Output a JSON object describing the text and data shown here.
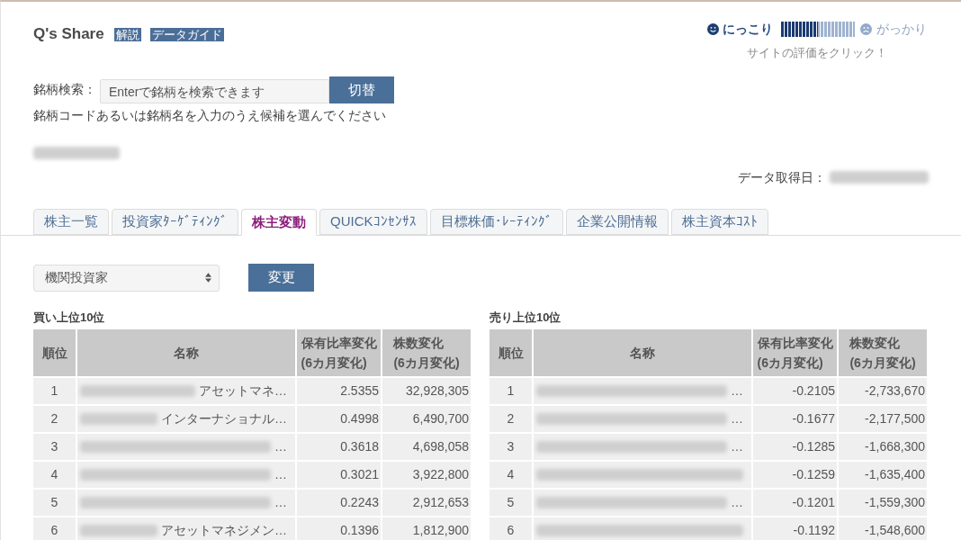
{
  "header": {
    "title": "Q's Share",
    "links": [
      "解説",
      "データガイド"
    ]
  },
  "rating": {
    "positive_label": "にっこり",
    "level": 0.5,
    "negative_label": "がっかり",
    "hint": "サイトの評価をクリック！"
  },
  "search": {
    "label": "銘柄検索：",
    "placeholder": "Enterで銘柄を検索できます",
    "button": "切替",
    "help": "銘柄コードあるいは銘柄名を入力のうえ候補を選んでください"
  },
  "company": {
    "blurred": true
  },
  "data_date": {
    "label": "データ取得日：",
    "value_blurred": true
  },
  "tabs": [
    {
      "label": "株主一覧",
      "selected": false
    },
    {
      "label": "投資家ﾀｰｹﾞﾃｨﾝｸﾞ",
      "selected": false
    },
    {
      "label": "株主変動",
      "selected": true
    },
    {
      "label": "QUICKｺﾝｾﾝｻｽ",
      "selected": false
    },
    {
      "label": "目標株価･ﾚｰﾃｨﾝｸﾞ",
      "selected": false
    },
    {
      "label": "企業公開情報",
      "selected": false
    },
    {
      "label": "株主資本ｺｽﾄ",
      "selected": false
    }
  ],
  "filter": {
    "value": "機関投資家",
    "button": "変更"
  },
  "tables": [
    {
      "title": "買い上位10位",
      "columns": [
        {
          "label": "順位"
        },
        {
          "label": "名称"
        },
        {
          "label": "保有比率変化",
          "sublabel": "(6カ月変化)"
        },
        {
          "label": "株数変化",
          "sublabel": "(6カ月変化)"
        }
      ],
      "rows": [
        {
          "rank": "1",
          "name": "アセットマネ…",
          "blurred": true,
          "ratio": "2.5355",
          "shares": "32,928,305"
        },
        {
          "rank": "2",
          "name": "インターナショナル…",
          "blurred": true,
          "ratio": "0.4998",
          "shares": "6,490,700"
        },
        {
          "rank": "3",
          "name": "…",
          "blurred": true,
          "ratio": "0.3618",
          "shares": "4,698,058"
        },
        {
          "rank": "4",
          "name": "…",
          "blurred": true,
          "ratio": "0.3021",
          "shares": "3,922,800"
        },
        {
          "rank": "5",
          "name": "…",
          "blurred": true,
          "ratio": "0.2243",
          "shares": "2,912,653"
        },
        {
          "rank": "6",
          "name": "アセットマネジメン…",
          "blurred": true,
          "ratio": "0.1396",
          "shares": "1,812,900"
        }
      ]
    },
    {
      "title": "売り上位10位",
      "columns": [
        {
          "label": "順位"
        },
        {
          "label": "名称"
        },
        {
          "label": "保有比率変化",
          "sublabel": "(6カ月変化)"
        },
        {
          "label": "株数変化",
          "sublabel": "(6カ月変化)"
        }
      ],
      "rows": [
        {
          "rank": "1",
          "name": "…",
          "blurred": true,
          "ratio": "-0.2105",
          "shares": "-2,733,670"
        },
        {
          "rank": "2",
          "name": "…",
          "blurred": true,
          "ratio": "-0.1677",
          "shares": "-2,177,500"
        },
        {
          "rank": "3",
          "name": "…",
          "blurred": true,
          "ratio": "-0.1285",
          "shares": "-1,668,300"
        },
        {
          "rank": "4",
          "blurred": true,
          "ratio": "-0.1259",
          "shares": "-1,635,400"
        },
        {
          "rank": "5",
          "name": "…",
          "blurred": true,
          "ratio": "-0.1201",
          "shares": "-1,559,300"
        },
        {
          "rank": "6",
          "blurred": true,
          "ratio": "-0.1192",
          "shares": "-1,548,600"
        }
      ]
    }
  ]
}
